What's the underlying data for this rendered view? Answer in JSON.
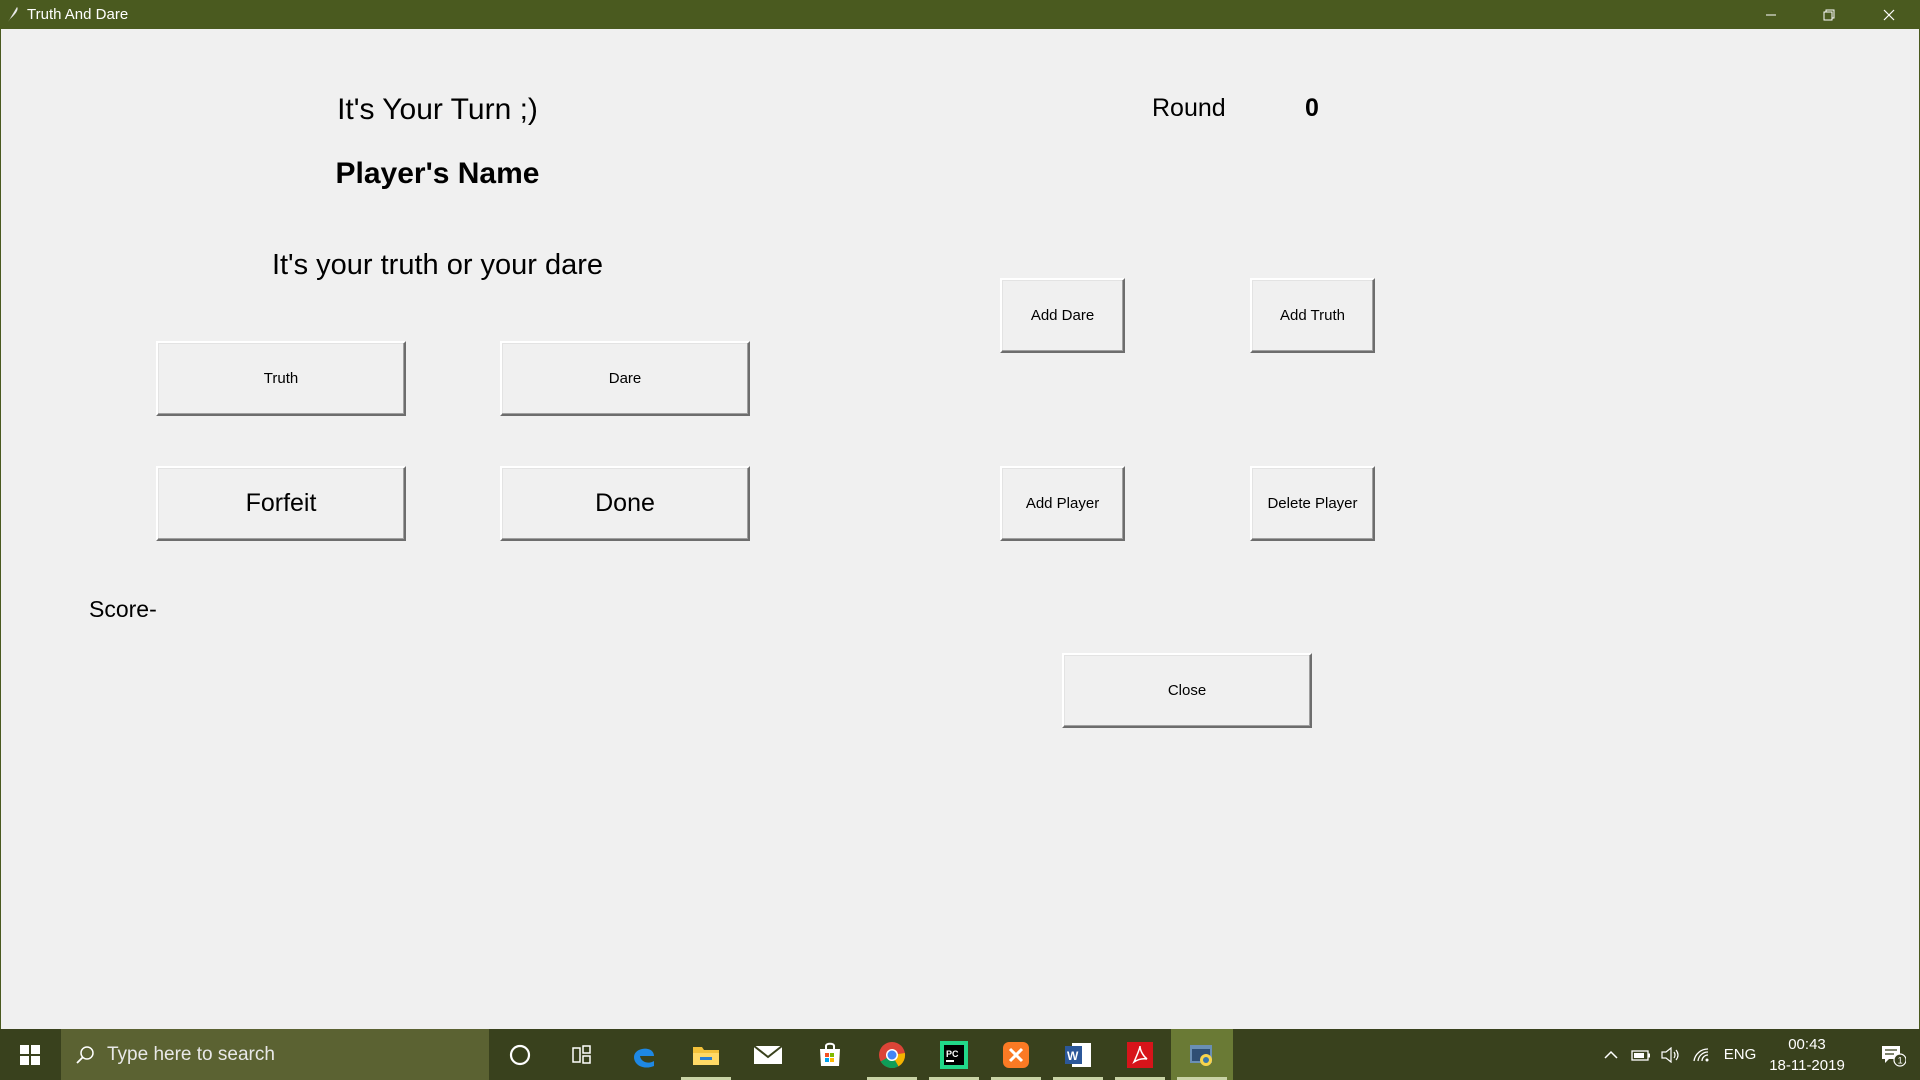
{
  "window": {
    "title": "Truth And Dare"
  },
  "game": {
    "turn_label": "It's Your Turn ;)",
    "player_name": "Player's Name",
    "prompt_text": "It's your truth or your dare",
    "round_label": "Round",
    "round_value": "0",
    "score_label": "Score-"
  },
  "buttons": {
    "truth": "Truth",
    "dare": "Dare",
    "forfeit": "Forfeit",
    "done": "Done",
    "add_dare": "Add Dare",
    "add_truth": "Add Truth",
    "add_player": "Add Player",
    "delete_player": "Delete Player",
    "close": "Close"
  },
  "taskbar": {
    "search_placeholder": "Type here to search",
    "apps": [
      "cortana-icon",
      "task-view-icon",
      "edge-icon",
      "file-explorer-icon",
      "mail-icon",
      "store-icon",
      "chrome-icon",
      "pycharm-icon",
      "xampp-icon",
      "word-icon",
      "acrobat-icon",
      "python-app-icon"
    ],
    "language": "ENG",
    "time": "00:43",
    "date": "18-11-2019",
    "notification_count": "1"
  },
  "colors": {
    "titlebar": "#4a5a1f",
    "taskbar": "#39411d",
    "window_bg": "#f0f0f0"
  }
}
